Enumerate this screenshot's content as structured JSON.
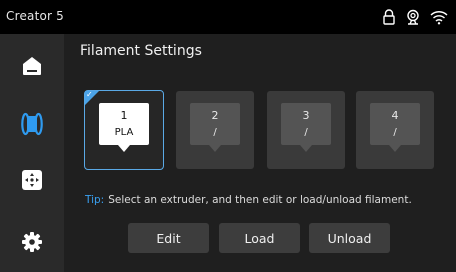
{
  "status_bar": {
    "device_name": "Creator 5",
    "icons": [
      "lock-icon",
      "webcam-icon",
      "wifi-icon"
    ]
  },
  "sidebar": {
    "items": [
      {
        "name": "home",
        "icon": "home-icon",
        "active": false
      },
      {
        "name": "filament",
        "icon": "filament-spool-icon",
        "active": true
      },
      {
        "name": "control",
        "icon": "move-control-icon",
        "active": false
      },
      {
        "name": "settings",
        "icon": "gear-icon",
        "active": false
      }
    ]
  },
  "main": {
    "title": "Filament Settings",
    "extruders": [
      {
        "number": "1",
        "material": "PLA",
        "selected": true
      },
      {
        "number": "2",
        "material": "/",
        "selected": false
      },
      {
        "number": "3",
        "material": "/",
        "selected": false
      },
      {
        "number": "4",
        "material": "/",
        "selected": false
      }
    ],
    "tip_label": "Tip:",
    "tip_text": "Select an extruder, and then edit or load/unload filament.",
    "buttons": {
      "edit": "Edit",
      "load": "Load",
      "unload": "Unload"
    }
  },
  "colors": {
    "accent": "#3aa0f0",
    "background": "#1f1f1f",
    "sidebar": "#2a2a2a",
    "statusbar": "#000000",
    "tile": "#3a3a3a",
    "button": "#3d3d3d"
  }
}
